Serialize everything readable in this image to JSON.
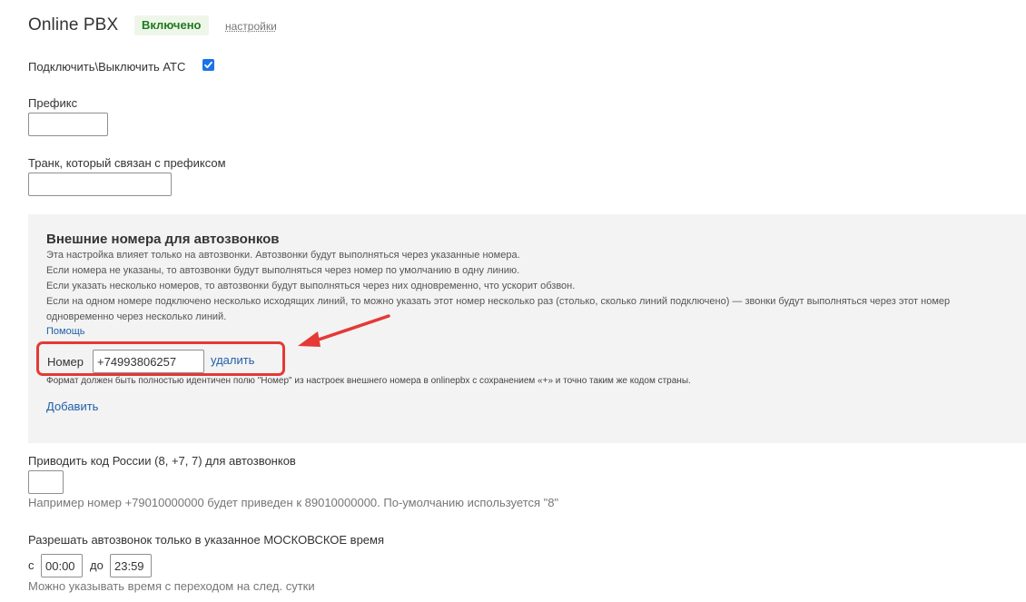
{
  "header": {
    "title": "Online PBX",
    "status": "Включено",
    "settings_link": "настройки"
  },
  "toggle": {
    "label": "Подключить\\Выключить АТС",
    "checked": true
  },
  "prefix": {
    "label": "Префикс",
    "value": ""
  },
  "trunk": {
    "label": "Транк, который связан с префиксом",
    "value": ""
  },
  "external_numbers": {
    "title": "Внешние номера для автозвонков",
    "description": [
      "Эта настройка влияет только на автозвонки. Автозвонки будут выполняться через указанные номера.",
      "Если номера не указаны, то автозвонки будут выполняться через номер по умолчанию в одну линию.",
      "Если указать несколько номеров, то автозвонки будут выполняться через них одновременно, что ускорит обзвон.",
      "Если на одном номере подключено несколько исходящих линий, то можно указать этот номер несколько раз (столько, сколько линий подключено) — звонки будут выполняться через этот номер",
      "одновременно через несколько линий."
    ],
    "help_link": "Помощь",
    "number_label": "Номер",
    "number_value": "+74993806257",
    "delete_link": "удалить",
    "format_note": "Формат должен быть полностью идентичен полю \"Номер\" из настроек внешнего номера в onlinepbx с сохранением «+» и точно таким же кодом страны.",
    "add_link": "Добавить"
  },
  "country_code": {
    "label": "Приводить код России (8, +7, 7) для автозвонков",
    "value": "",
    "hint": "Например номер +79010000000 будет приведен к 89010000000. По-умолчанию используется \"8\""
  },
  "time_window": {
    "label": "Разрешать автозвонок только в указанное МОСКОВСКОЕ время",
    "from_label": "с",
    "from_value": "00:00",
    "to_label": "до",
    "to_value": "23:59",
    "hint": "Можно указывать время с переходом на след. сутки"
  },
  "colors": {
    "accent_blue": "#1f5fa8",
    "badge_green": "#1f7a1f",
    "highlight_red": "#e53935",
    "panel_bg": "#f3f3f3"
  }
}
